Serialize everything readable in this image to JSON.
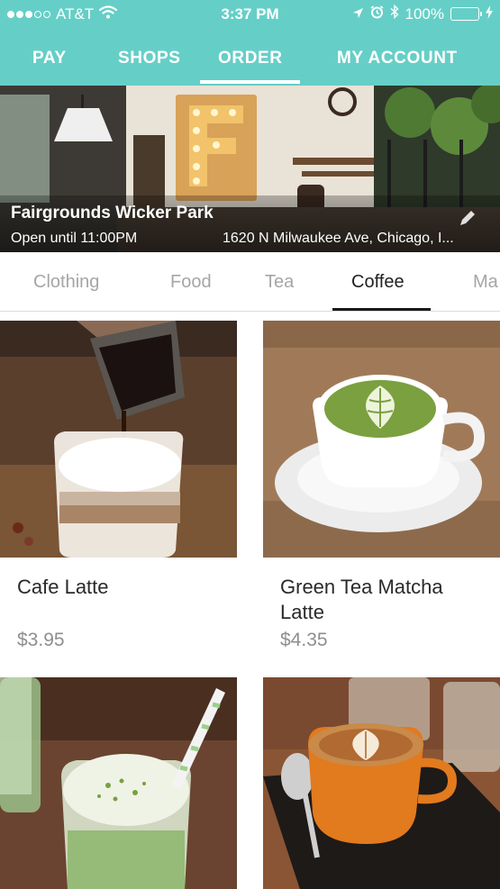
{
  "status_bar": {
    "carrier": "AT&T",
    "time": "3:37 PM",
    "battery": "100%",
    "signal_bars_filled": 3,
    "signal_bars_total": 5,
    "icons": [
      "wifi-icon",
      "location-arrow-icon",
      "alarm-icon",
      "bluetooth-icon",
      "battery-icon",
      "charging-icon"
    ]
  },
  "nav": {
    "tabs": [
      {
        "label": "PAY"
      },
      {
        "label": "SHOPS"
      },
      {
        "label": "ORDER"
      },
      {
        "label": "MY ACCOUNT"
      }
    ],
    "active": "ORDER"
  },
  "store": {
    "name": "Fairgrounds Wicker Park",
    "hours": "Open until 11:00PM",
    "address": "1620 N Milwaukee Ave, Chicago, I...",
    "icons": [
      "edit-icon"
    ]
  },
  "categories": {
    "items": [
      {
        "label": "Clothing"
      },
      {
        "label": "Food"
      },
      {
        "label": "Tea"
      },
      {
        "label": "Coffee"
      },
      {
        "label": "Ma"
      }
    ],
    "active": "Coffee"
  },
  "products": [
    {
      "name": "Cafe Latte",
      "price": "$3.95"
    },
    {
      "name": "Green Tea Matcha Latte",
      "price": "$4.35"
    },
    {
      "name": "",
      "price": ""
    },
    {
      "name": "",
      "price": ""
    }
  ],
  "colors": {
    "brand": "#65cfc7",
    "battery_fill": "#4cd964",
    "active_text": "#222222",
    "inactive_text": "#a6a6a6",
    "price_text": "#8e8e8e"
  }
}
